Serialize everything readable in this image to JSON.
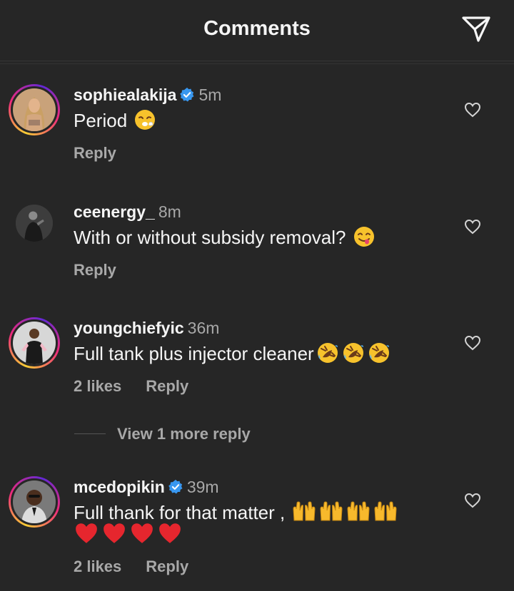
{
  "header": {
    "title": "Comments",
    "send_icon": "send-icon"
  },
  "comments": [
    {
      "username": "sophiealakija",
      "verified": true,
      "time": "5m",
      "text": "Period",
      "emojis": [
        "exhausted-face"
      ],
      "likes": "",
      "reply": "Reply"
    },
    {
      "username": "ceenergy_",
      "verified": false,
      "time": "8m",
      "text": "With or without subsidy removal?",
      "emojis": [
        "yum-face"
      ],
      "likes": "",
      "reply": "Reply"
    },
    {
      "username": "youngchiefyic",
      "verified": false,
      "time": "36m",
      "text": "Full tank plus injector cleaner",
      "emojis": [
        "rofl",
        "rofl",
        "rofl"
      ],
      "likes": "2 likes",
      "reply": "Reply"
    },
    {
      "username": "mcedopikin",
      "verified": true,
      "time": "39m",
      "text": "Full thank for that matter ,",
      "emojis": [
        "raised-hands",
        "raised-hands",
        "raised-hands",
        "raised-hands",
        "red-heart",
        "red-heart",
        "red-heart",
        "red-heart"
      ],
      "likes": "2 likes",
      "reply": "Reply"
    }
  ],
  "view_more": "View 1 more reply",
  "colors": {
    "background": "#262626",
    "secondary_text": "#a8a8a8",
    "verified": "#3897f0"
  }
}
